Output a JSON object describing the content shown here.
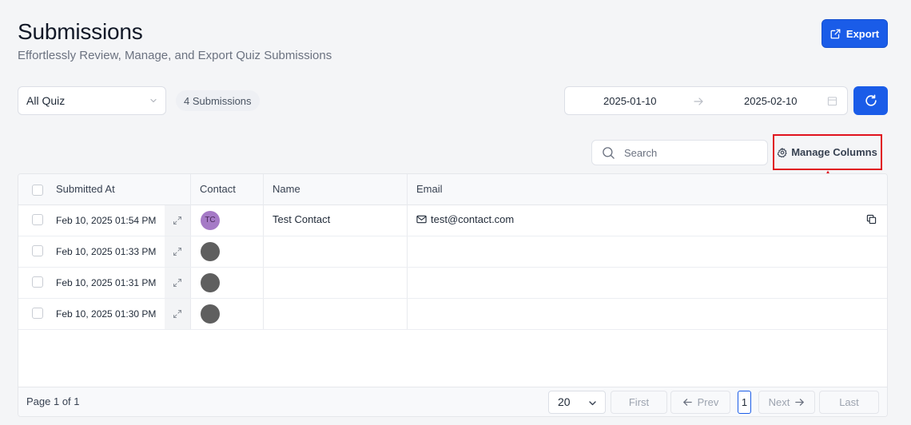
{
  "header": {
    "title": "Submissions",
    "subtitle": "Effortlessly Review, Manage, and Export Quiz Submissions",
    "export_label": "Export"
  },
  "filters": {
    "quiz_select_value": "All Quiz",
    "submission_count": "4 Submissions",
    "date_start": "2025-01-10",
    "date_end": "2025-02-10",
    "search_placeholder": "Search",
    "manage_columns_label": "Manage Columns"
  },
  "table": {
    "columns": [
      "Submitted At",
      "Contact",
      "Name",
      "Email"
    ],
    "rows": [
      {
        "submitted_at": "Feb 10, 2025  01:54 PM",
        "contact_initials": "TC",
        "name": "Test Contact",
        "email": "test@contact.com"
      },
      {
        "submitted_at": "Feb 10, 2025  01:33 PM",
        "contact_initials": "",
        "name": "",
        "email": ""
      },
      {
        "submitted_at": "Feb 10, 2025  01:31 PM",
        "contact_initials": "",
        "name": "",
        "email": ""
      },
      {
        "submitted_at": "Feb 10, 2025  01:30 PM",
        "contact_initials": "",
        "name": "",
        "email": ""
      }
    ]
  },
  "pagination": {
    "page_info": "Page 1 of 1",
    "per_page": "20",
    "first_label": "First",
    "prev_label": "Prev",
    "current_page": "1",
    "next_label": "Next",
    "last_label": "Last"
  },
  "colors": {
    "primary": "#1a5ce8",
    "annotation": "#e0121d",
    "avatar_tc": "#a57ac6",
    "avatar_default": "#5f5f5f"
  }
}
